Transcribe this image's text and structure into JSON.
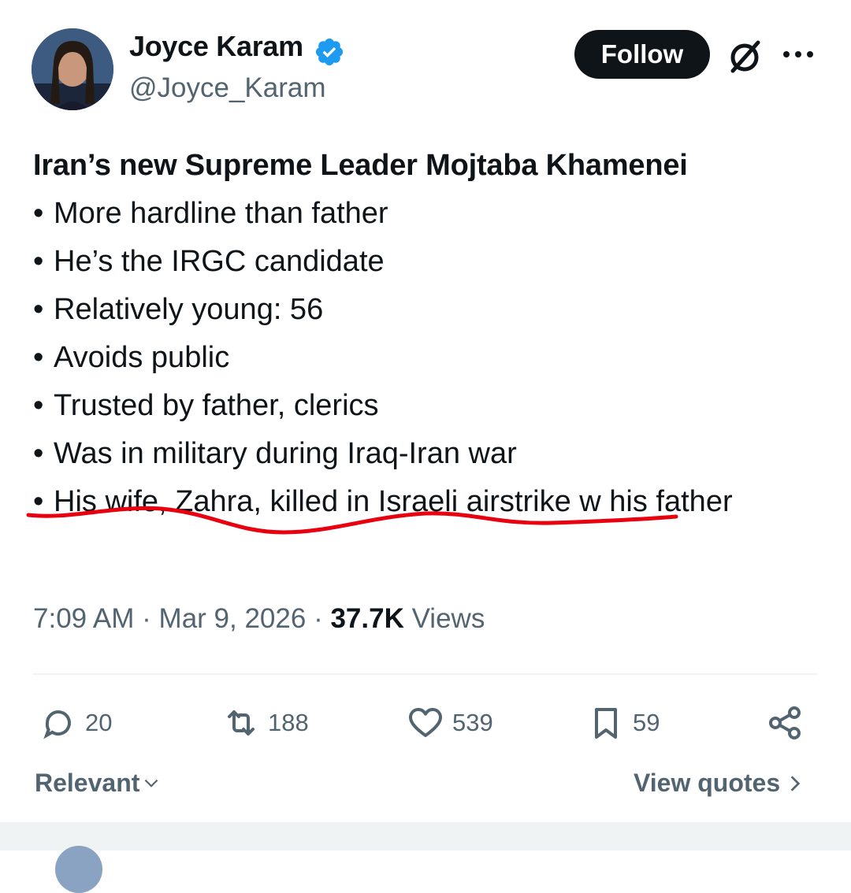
{
  "author": {
    "name": "Joyce Karam",
    "handle": "@Joyce_Karam",
    "verified": true,
    "verified_color": "#1d9bf0"
  },
  "header": {
    "follow_label": "Follow",
    "grok_icon": "grok-icon",
    "more_icon": "more-icon"
  },
  "tweet": {
    "headline": "Iran’s new Supreme Leader Mojtaba Khamenei",
    "bullet_char": "•",
    "bullets": [
      "More hardline than father",
      "He’s the IRGC candidate",
      "Relatively young: 56",
      "Avoids public",
      "Trusted by father, clerics",
      "Was in military during Iraq-Iran war",
      "His wife, Zahra, killed in Israeli airstrike w his father"
    ],
    "annotation_color": "#e8000f"
  },
  "meta": {
    "time": "7:09 AM",
    "separator": "·",
    "date": "Mar 9, 2026",
    "views_count": "37.7K",
    "views_label": "Views"
  },
  "actions": {
    "replies": "20",
    "reposts": "188",
    "likes": "539",
    "bookmarks": "59"
  },
  "footer": {
    "sort_label": "Relevant",
    "view_quotes_label": "View quotes"
  },
  "colors": {
    "text_primary": "#0f1419",
    "text_secondary": "#536471",
    "divider": "#eff3f4"
  }
}
